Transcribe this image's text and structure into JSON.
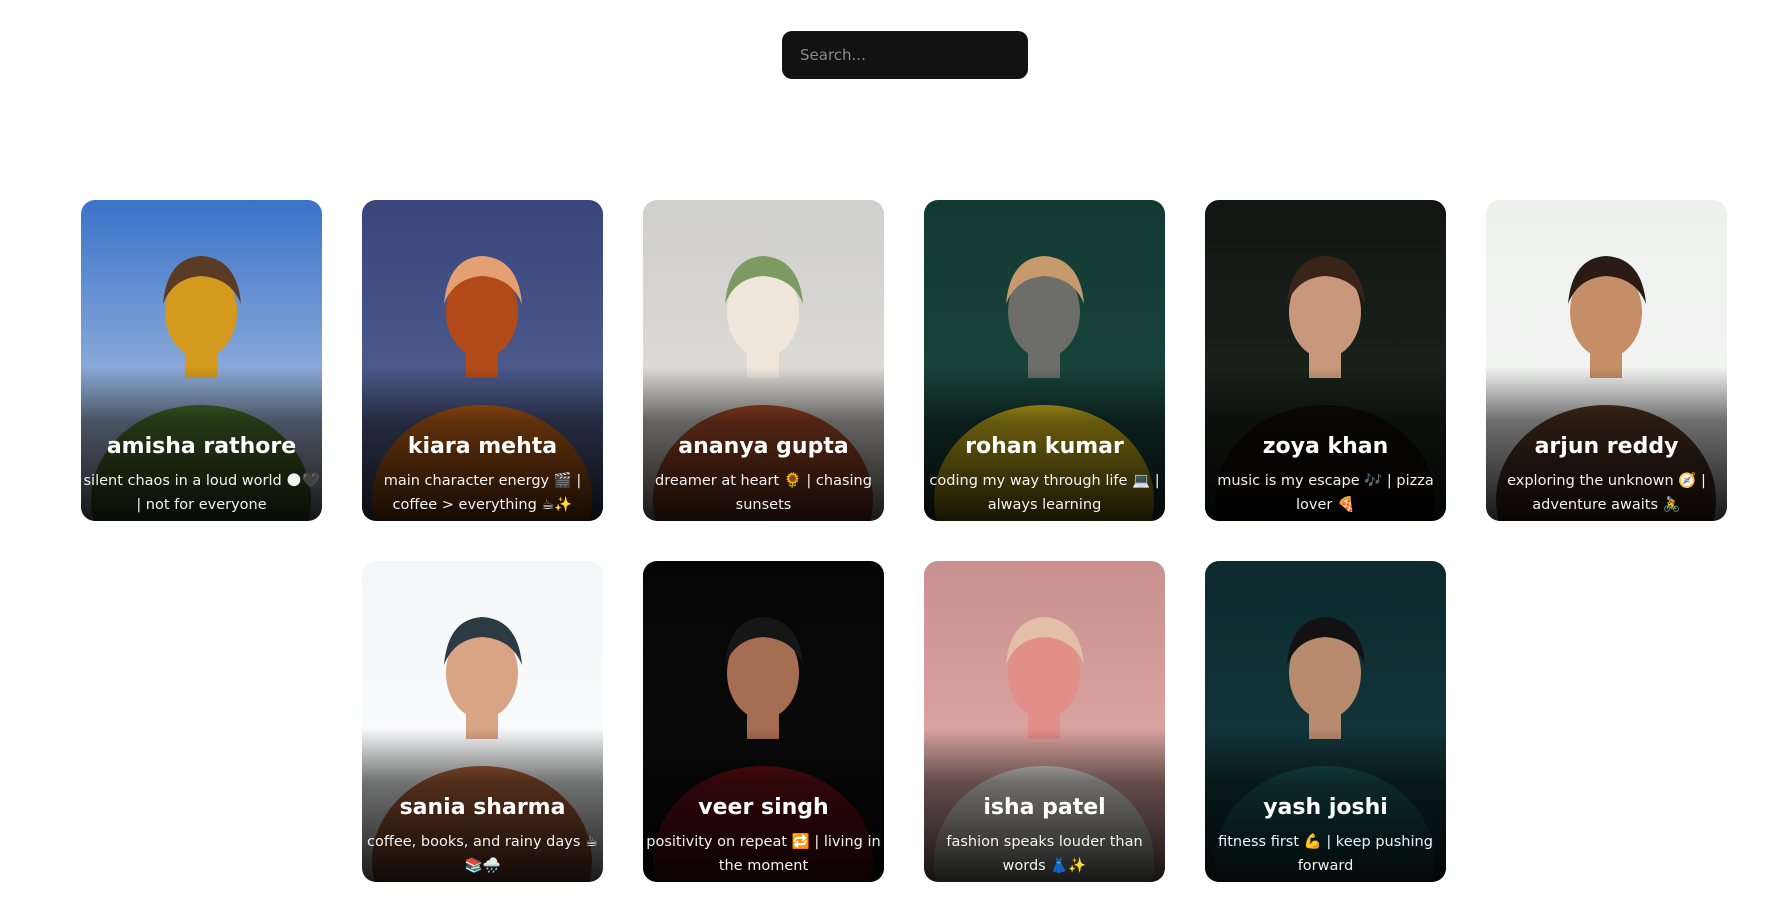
{
  "search": {
    "placeholder": "Search...",
    "value": ""
  },
  "profiles": [
    {
      "name": "amisha rathore",
      "bio": "silent chaos in a loud world 🌑🖤 | not for everyone",
      "photo_colors": [
        "#3b73c9",
        "#cfd9e6",
        "#4f7a2e",
        "#d39a1e",
        "#5a3b26"
      ]
    },
    {
      "name": "kiara mehta",
      "bio": "main character energy 🎬 | coffee > everything ☕✨",
      "photo_colors": [
        "#39457c",
        "#5b6a97",
        "#d46a18",
        "#b24a1a",
        "#e4a072"
      ]
    },
    {
      "name": "ananya gupta",
      "bio": "dreamer at heart 🌻 | chasing sunsets",
      "photo_colors": [
        "#cfcfcc",
        "#e7e4de",
        "#b5522a",
        "#f0e6dc",
        "#7d9a62"
      ]
    },
    {
      "name": "rohan kumar",
      "bio": "coding my way through life 💻 | always learning",
      "photo_colors": [
        "#123a33",
        "#1c4a40",
        "#e6c81e",
        "#6d6d6a",
        "#c79a6e"
      ]
    },
    {
      "name": "zoya khan",
      "bio": "music is my escape 🎶 | pizza lover 🍕",
      "photo_colors": [
        "#121612",
        "#1e2a22",
        "#120c0a",
        "#c9987c",
        "#3a2418"
      ]
    },
    {
      "name": "arjun reddy",
      "bio": "exploring the unknown 🧭 | adventure awaits 🚴",
      "photo_colors": [
        "#eef0ee",
        "#f6f7f6",
        "#5a3a24",
        "#c68e66",
        "#2a1c14"
      ]
    },
    {
      "name": "sania sharma",
      "bio": "coffee, books, and rainy days ☕📚🌧️",
      "photo_colors": [
        "#f4f6f8",
        "#ffffff",
        "#b5653c",
        "#d9a486",
        "#2c3a44"
      ]
    },
    {
      "name": "veer singh",
      "bio": "positivity on repeat 🔁 | living in the moment",
      "photo_colors": [
        "#050505",
        "#0d0d0d",
        "#6b0f14",
        "#a56d52",
        "#161616"
      ]
    },
    {
      "name": "isha patel",
      "bio": "fashion speaks louder than words 👗✨",
      "photo_colors": [
        "#c99090",
        "#e6b3ad",
        "#f4f2ee",
        "#e28f8a",
        "#e2bfa6"
      ]
    },
    {
      "name": "yash joshi",
      "bio": "fitness first 💪 | keep pushing forward",
      "photo_colors": [
        "#0d2a2e",
        "#153d42",
        "#1a5a5c",
        "#b88b6e",
        "#121212"
      ]
    }
  ]
}
